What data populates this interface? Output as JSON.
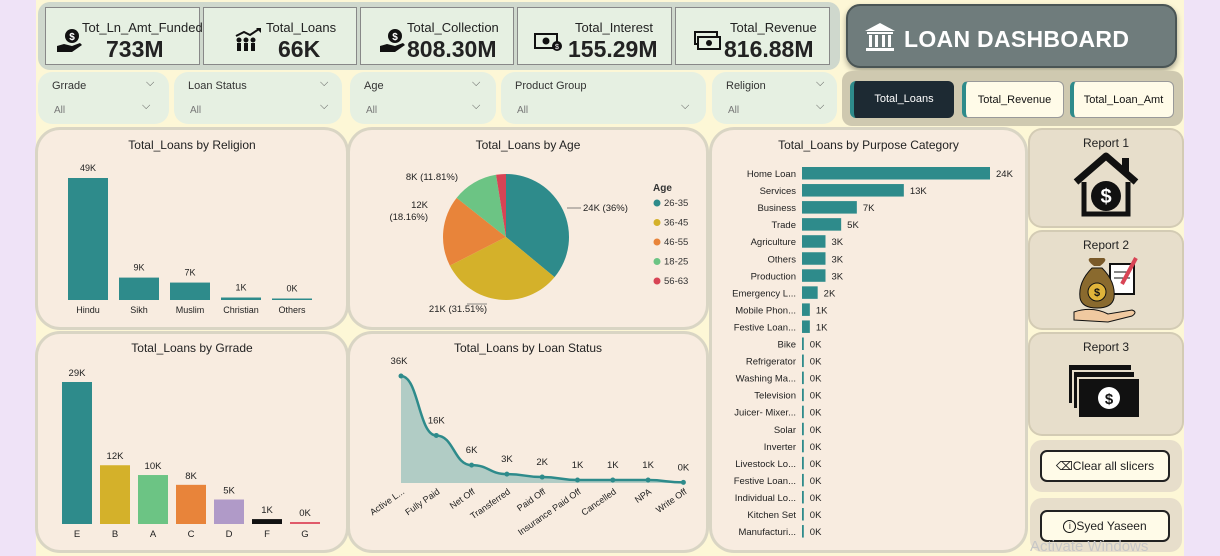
{
  "kpis": [
    {
      "label": "Tot_Ln_Amt_Funded",
      "value": "733M",
      "icon": "money-hand-icon"
    },
    {
      "label": "Total_Loans",
      "value": "66K",
      "icon": "people-growth-icon"
    },
    {
      "label": "Total_Collection",
      "value": "808.30M",
      "icon": "money-hand-icon"
    },
    {
      "label": "Total_Interest",
      "value": "155.29M",
      "icon": "cash-icon"
    },
    {
      "label": "Total_Revenue",
      "value": "816.88M",
      "icon": "cash-stack-icon"
    }
  ],
  "header": {
    "title": "LOAN DASHBOARD",
    "icon": "bank-icon"
  },
  "slicers": [
    {
      "label": "Grrade",
      "value": "All"
    },
    {
      "label": "Loan Status",
      "value": "All"
    },
    {
      "label": "Age",
      "value": "All"
    },
    {
      "label": "Product Group",
      "value": "All"
    },
    {
      "label": "Religion",
      "value": "All"
    }
  ],
  "toggles": [
    {
      "label": "Total_Loans",
      "active": true
    },
    {
      "label": "Total_Revenue",
      "active": false
    },
    {
      "label": "Total_Loan_Amt",
      "active": false
    }
  ],
  "colors": {
    "teal": "#2e8b8b",
    "mustard": "#d4b12a",
    "green": "#6cc484",
    "orange": "#e8843a",
    "purple": "#b09ac8",
    "black": "#111111",
    "pink": "#e05a6a",
    "red": "#d84455"
  },
  "reports": [
    {
      "label": "Report 1",
      "icon": "house-dollar-icon"
    },
    {
      "label": "Report 2",
      "icon": "money-bag-icon"
    },
    {
      "label": "Report 3",
      "icon": "banknotes-icon"
    }
  ],
  "actions": {
    "clear": "Clear all slicers",
    "author": "Syed Yaseen"
  },
  "watermark": "Activate Windows",
  "chart_data": [
    {
      "type": "bar",
      "title": "Total_Loans by Religion",
      "categories": [
        "Hindu",
        "Sikh",
        "Muslim",
        "Christian",
        "Others"
      ],
      "values": [
        49,
        9,
        7,
        1,
        0.3
      ],
      "labels": [
        "49K",
        "9K",
        "7K",
        "1K",
        "0K"
      ],
      "ylim": [
        0,
        49
      ]
    },
    {
      "type": "pie",
      "title": "Total_Loans by Age",
      "legend_title": "Age",
      "categories": [
        "26-35",
        "36-45",
        "46-55",
        "18-25",
        "56-63"
      ],
      "values": [
        36,
        31.51,
        18.16,
        11.81,
        2.52
      ],
      "slice_labels": [
        "24K (36%)",
        "21K (31.51%)",
        "12K (18.16%)",
        "8K (11.81%)",
        ""
      ],
      "legend": "right"
    },
    {
      "type": "bar",
      "title": "Total_Loans by Purpose Category",
      "orientation": "horizontal",
      "categories": [
        "Home Loan",
        "Services",
        "Business",
        "Trade",
        "Agriculture",
        "Others",
        "Production",
        "Emergency L...",
        "Mobile Phon...",
        "Festive Loan...",
        "Bike",
        "Refrigerator",
        "Washing Ma...",
        "Television",
        "Juicer- Mixer...",
        "Solar",
        "Inverter",
        "Livestock Lo...",
        "Festive Loan...",
        "Individual Lo...",
        "Kitchen Set",
        "Manufacturi..."
      ],
      "values": [
        24,
        13,
        7,
        5,
        3,
        3,
        3,
        2,
        1,
        1,
        0.1,
        0.1,
        0.1,
        0.1,
        0.1,
        0.1,
        0.1,
        0.1,
        0.1,
        0.1,
        0.1,
        0.1
      ],
      "labels": [
        "24K",
        "13K",
        "7K",
        "5K",
        "3K",
        "3K",
        "3K",
        "2K",
        "1K",
        "1K",
        "0K",
        "0K",
        "0K",
        "0K",
        "0K",
        "0K",
        "0K",
        "0K",
        "0K",
        "0K",
        "0K",
        "0K"
      ]
    },
    {
      "type": "bar",
      "title": "Total_Loans by Grrade",
      "categories": [
        "E",
        "B",
        "A",
        "C",
        "D",
        "F",
        "G"
      ],
      "values": [
        29,
        12,
        10,
        8,
        5,
        1,
        0.3
      ],
      "labels": [
        "29K",
        "12K",
        "10K",
        "8K",
        "5K",
        "1K",
        "0K"
      ],
      "ylim": [
        0,
        29
      ]
    },
    {
      "type": "area",
      "title": "Total_Loans by Loan Status",
      "categories": [
        "Active L...",
        "Fully Paid",
        "Net Off",
        "Transferred",
        "Paid Off",
        "Insurance Paid Off",
        "Cancelled",
        "NPA",
        "Write Off"
      ],
      "values": [
        36,
        16,
        6,
        3,
        2,
        1,
        1,
        1,
        0.2
      ],
      "labels": [
        "36K",
        "16K",
        "6K",
        "3K",
        "2K",
        "1K",
        "1K",
        "1K",
        "0K"
      ]
    }
  ]
}
